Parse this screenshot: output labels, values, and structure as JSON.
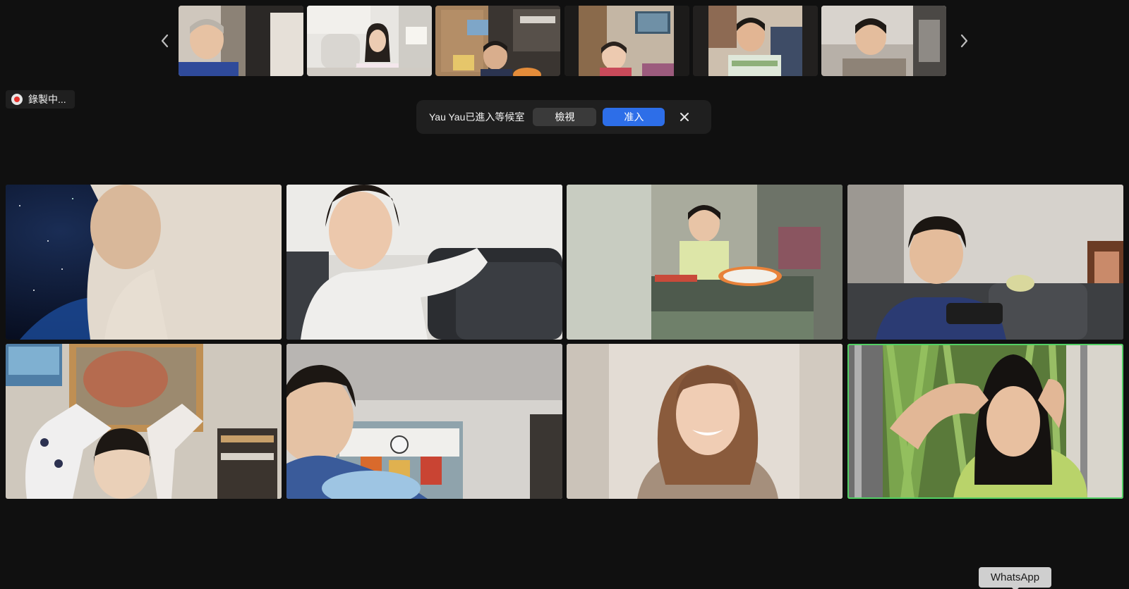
{
  "recording": {
    "label": "錄製中..."
  },
  "notification": {
    "message": "Yau Yau已進入等候室",
    "view_label": "檢視",
    "admit_label": "准入"
  },
  "thumbnails": [
    {
      "id": "thumb-1",
      "icon": "video-thumbnail"
    },
    {
      "id": "thumb-2",
      "icon": "video-thumbnail"
    },
    {
      "id": "thumb-3",
      "icon": "video-thumbnail"
    },
    {
      "id": "thumb-4",
      "icon": "video-thumbnail"
    },
    {
      "id": "thumb-5",
      "icon": "video-thumbnail"
    },
    {
      "id": "thumb-6",
      "icon": "video-thumbnail"
    }
  ],
  "gallery": {
    "active_speaker_index": 7,
    "active_border_color": "#52d064"
  },
  "tooltip": {
    "label": "WhatsApp"
  },
  "colors": {
    "background": "#101010",
    "admit_button": "#2d6ee8",
    "view_button": "#3a3a3a",
    "recording_dot": "#e5322d"
  },
  "icons": {
    "prev": "chevron-left-icon",
    "next": "chevron-right-icon",
    "close": "close-icon",
    "recording": "record-dot-icon"
  }
}
